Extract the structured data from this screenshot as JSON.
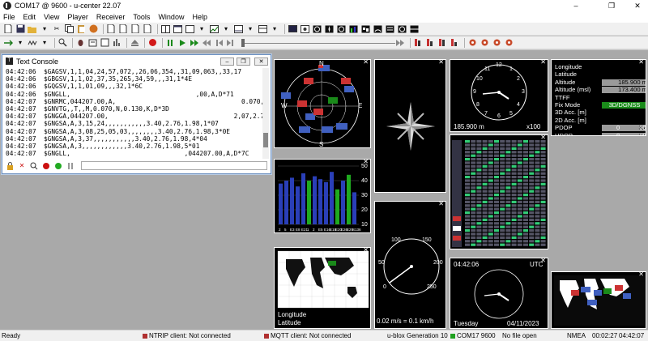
{
  "window": {
    "title": "COM17 @ 9600 - u-center 22.07",
    "minimize": "–",
    "maximize": "❐",
    "close": "✕"
  },
  "menu": [
    "File",
    "Edit",
    "View",
    "Player",
    "Receiver",
    "Tools",
    "Window",
    "Help"
  ],
  "console": {
    "title": "Text Console",
    "lines": [
      "04:42:06  $GAGSV,1,1,04,24,57,072,,26,06,354,,31,09,063,,33,17",
      "04:42:06  $GBGSV,1,1,02,37,35,265,34,59,,,31,1*4E",
      "04:42:06  $GQGSV,1,1,01,09,,,32,1*6C",
      "04:42:06  $GNGLL,                                 ,00,A,D*71",
      "04:42:07  $GNRMC,044207.00,A,                                 0.070,",
      "04:42:07  $GNVTG,,T,,M,0.070,N,0.130,K,D*3D",
      "04:42:07  $GNGGA,044207.00,                                 2,07,2.76",
      "04:42:07  $GNGSA,A,3,15,24,,,,,,,,,,,3.40,2.76,1.98,1*07",
      "04:42:07  $GNGSA,A,3,08,25,05,03,,,,,,,,3.40,2.76,1.98,3*0E",
      "04:42:07  $GNGSA,A,3,37,,,,,,,,,,,3.40,2.76,1.98,4*04",
      "04:42:07  $GNGSA,A,3,,,,,,,,,,,,3.40,2.76,1.98,5*01",
      "04:42:07  $GNGLL,                              ,044207.00,A,D*7C"
    ],
    "scrollbar_position": 0.85
  },
  "compass": {
    "n": "N",
    "e": "E",
    "s": "S",
    "w": "W"
  },
  "clock": {
    "numerals": [
      "12",
      "1",
      "2",
      "3",
      "4",
      "5",
      "6",
      "7",
      "8",
      "9",
      "10",
      "11"
    ],
    "altitude": "185.900 m",
    "zoom": "x100"
  },
  "signal": {
    "ticks": [
      "50",
      "40",
      "30",
      "20",
      "10"
    ],
    "sats": [
      "2",
      "5",
      "E3",
      "E8",
      "E21",
      "1",
      "2",
      "E5",
      "E16",
      "E19",
      "E20",
      "E26",
      "E29",
      "S136"
    ]
  },
  "speedo": {
    "ticks": [
      "0",
      "50",
      "100",
      "150",
      "200",
      "250"
    ],
    "speed": "0.02 m/s = 0.1 km/h"
  },
  "datatable": {
    "rows": [
      {
        "k": "Longitude",
        "v": ""
      },
      {
        "k": "Latitude",
        "v": ""
      },
      {
        "k": "Altitude",
        "v": "185.900 m"
      },
      {
        "k": "Altitude (msl)",
        "v": "173.400 m"
      },
      {
        "k": "TTFF",
        "v": ""
      },
      {
        "k": "Fix Mode",
        "v": "3D/DGNSS",
        "green": true
      },
      {
        "k": "3D Acc. [m]",
        "v": ""
      },
      {
        "k": "2D Acc. [m]",
        "v": ""
      },
      {
        "k": "PDOP",
        "v": "3.4"
      },
      {
        "k": "HDOP",
        "v": "2.8"
      },
      {
        "k": "Satellites",
        "v": ""
      }
    ],
    "pdop_a": "0",
    "pdop_b": "10",
    "hdop_a": "0",
    "hdop_b": "10"
  },
  "worldmap": {
    "longitude": "Longitude",
    "latitude": "Latitude"
  },
  "dateclock": {
    "time": "04:42:06",
    "tz": "UTC",
    "day": "Tuesday",
    "date": "04/11/2023"
  },
  "statusbar": {
    "ready": "Ready",
    "ntrip": "NTRIP client: Not connected",
    "mqtt": "MQTT client: Not connected",
    "gen": "u-blox Generation 10",
    "com": "COM17 9600",
    "file": "No file open",
    "proto": "NMEA",
    "t1": "00:02:27",
    "t2": "04:42:07"
  },
  "colors": {
    "us": "#c03030",
    "eu": "#3050c0",
    "bar_green": "#1faa1f",
    "bar_blue": "#2a3fb8",
    "connected": "#1fa01f",
    "ntrip": "#b03030"
  }
}
